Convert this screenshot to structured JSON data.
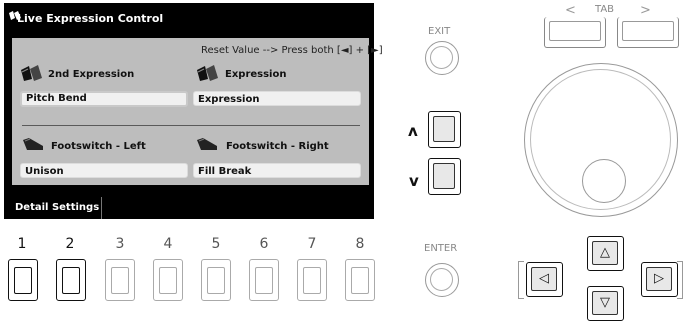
{
  "screen": {
    "title": "Live Expression Control",
    "reset_hint": "Reset Value --> Press both [◄] + [►]",
    "sections": [
      {
        "label": "2nd Expression",
        "value": "Pitch Bend"
      },
      {
        "label": "Expression",
        "value": "Expression"
      },
      {
        "label": "Footswitch - Left",
        "value": "Unison"
      },
      {
        "label": "Footswitch - Right",
        "value": "Fill Break"
      }
    ],
    "footer_button": "Detail Settings"
  },
  "number_buttons": [
    "1",
    "2",
    "3",
    "4",
    "5",
    "6",
    "7",
    "8"
  ],
  "active_number_buttons": [
    "1",
    "2"
  ],
  "panel": {
    "exit_label": "EXIT",
    "enter_label": "ENTER",
    "tab_label": "TAB",
    "tab_left": "<",
    "tab_right": ">",
    "up_glyph": "ʌ",
    "down_glyph": "v",
    "cursor_up": "△",
    "cursor_down": "▽",
    "cursor_left": "◁",
    "cursor_right": "▷"
  },
  "colors": {
    "lcd_bg": "#000000",
    "panel_bg": "#bdbdbd",
    "field_bg": "#f0f0f0",
    "inactive_outline": "#aaaaaa"
  },
  "icons": [
    "expression-pedal-icon",
    "footswitch-icon"
  ]
}
